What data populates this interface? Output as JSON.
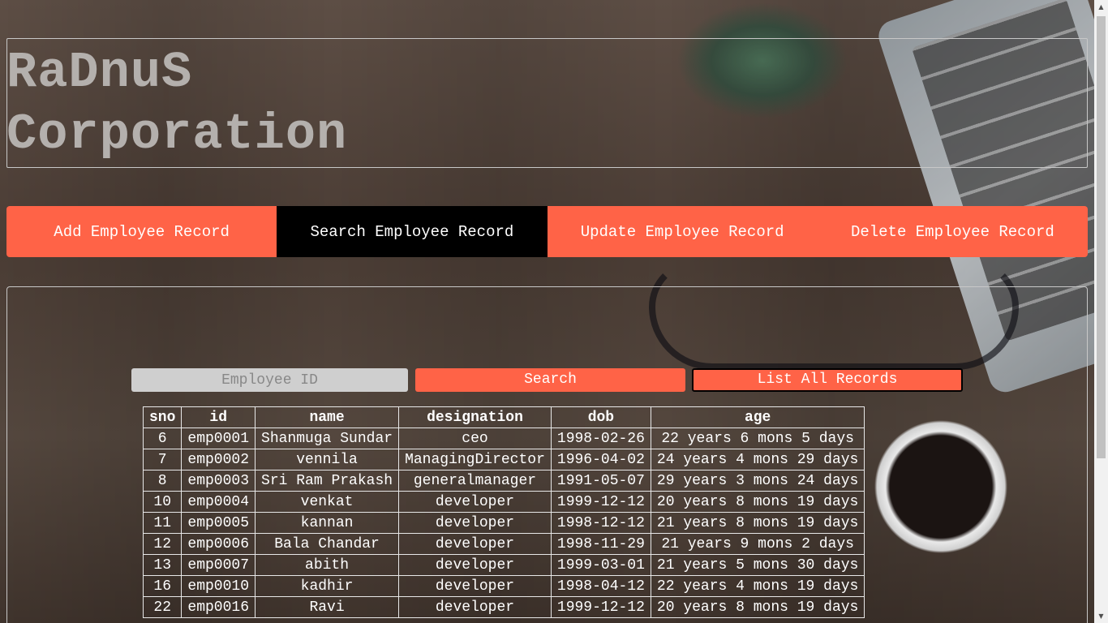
{
  "brand": {
    "line1": "RaDnuS",
    "line2": "Corporation"
  },
  "nav": [
    {
      "label": "Add Employee Record"
    },
    {
      "label": "Search Employee Record"
    },
    {
      "label": "Update Employee Record"
    },
    {
      "label": "Delete Employee Record"
    }
  ],
  "search": {
    "placeholder": "Employee ID",
    "search_label": "Search",
    "list_label": "List All Records"
  },
  "table": {
    "headers": [
      "sno",
      "id",
      "name",
      "designation",
      "dob",
      "age"
    ],
    "rows": [
      [
        "6",
        "emp0001",
        "Shanmuga Sundar",
        "ceo",
        "1998-02-26",
        "22 years 6 mons 5 days"
      ],
      [
        "7",
        "emp0002",
        "vennila",
        "ManagingDirector",
        "1996-04-02",
        "24 years 4 mons 29 days"
      ],
      [
        "8",
        "emp0003",
        "Sri Ram Prakash",
        "generalmanager",
        "1991-05-07",
        "29 years 3 mons 24 days"
      ],
      [
        "10",
        "emp0004",
        "venkat",
        "developer",
        "1999-12-12",
        "20 years 8 mons 19 days"
      ],
      [
        "11",
        "emp0005",
        "kannan",
        "developer",
        "1998-12-12",
        "21 years 8 mons 19 days"
      ],
      [
        "12",
        "emp0006",
        "Bala Chandar",
        "developer",
        "1998-11-29",
        "21 years 9 mons 2 days"
      ],
      [
        "13",
        "emp0007",
        "abith",
        "developer",
        "1999-03-01",
        "21 years 5 mons 30 days"
      ],
      [
        "16",
        "emp0010",
        "kadhir",
        "developer",
        "1998-04-12",
        "22 years 4 mons 19 days"
      ],
      [
        "22",
        "emp0016",
        "Ravi",
        "developer",
        "1999-12-12",
        "20 years 8 mons 19 days"
      ]
    ]
  },
  "colors": {
    "accent": "#ff6347",
    "active_tab": "#000000"
  }
}
